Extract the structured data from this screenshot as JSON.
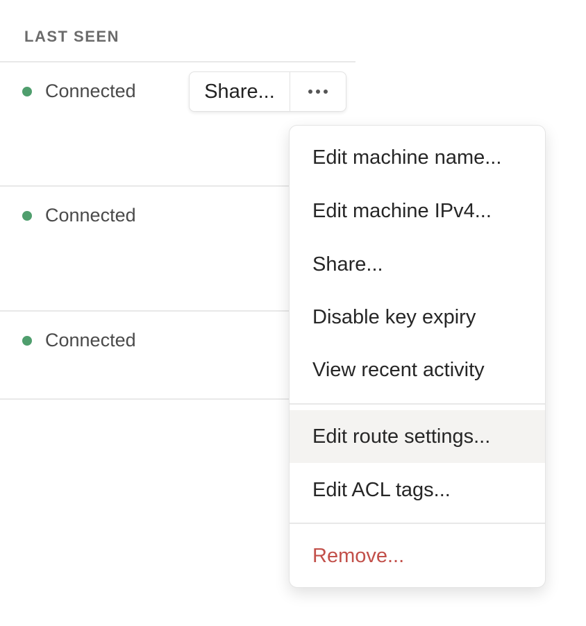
{
  "table": {
    "column_header": "LAST SEEN",
    "rows": [
      {
        "status": "Connected"
      },
      {
        "status": "Connected"
      },
      {
        "status": "Connected"
      }
    ]
  },
  "actions": {
    "share_label": "Share...",
    "more_icon": "ellipsis-horizontal-icon"
  },
  "menu": {
    "items": [
      {
        "label": "Edit machine name..."
      },
      {
        "label": "Edit machine IPv4..."
      },
      {
        "label": "Share..."
      },
      {
        "label": "Disable key expiry"
      },
      {
        "label": "View recent activity"
      },
      {
        "label": "Edit route settings..."
      },
      {
        "label": "Edit ACL tags..."
      },
      {
        "label": "Remove..."
      }
    ]
  },
  "colors": {
    "connected": "#4f9e6d",
    "danger": "#c2504a",
    "hover": "#f4f3f1"
  }
}
